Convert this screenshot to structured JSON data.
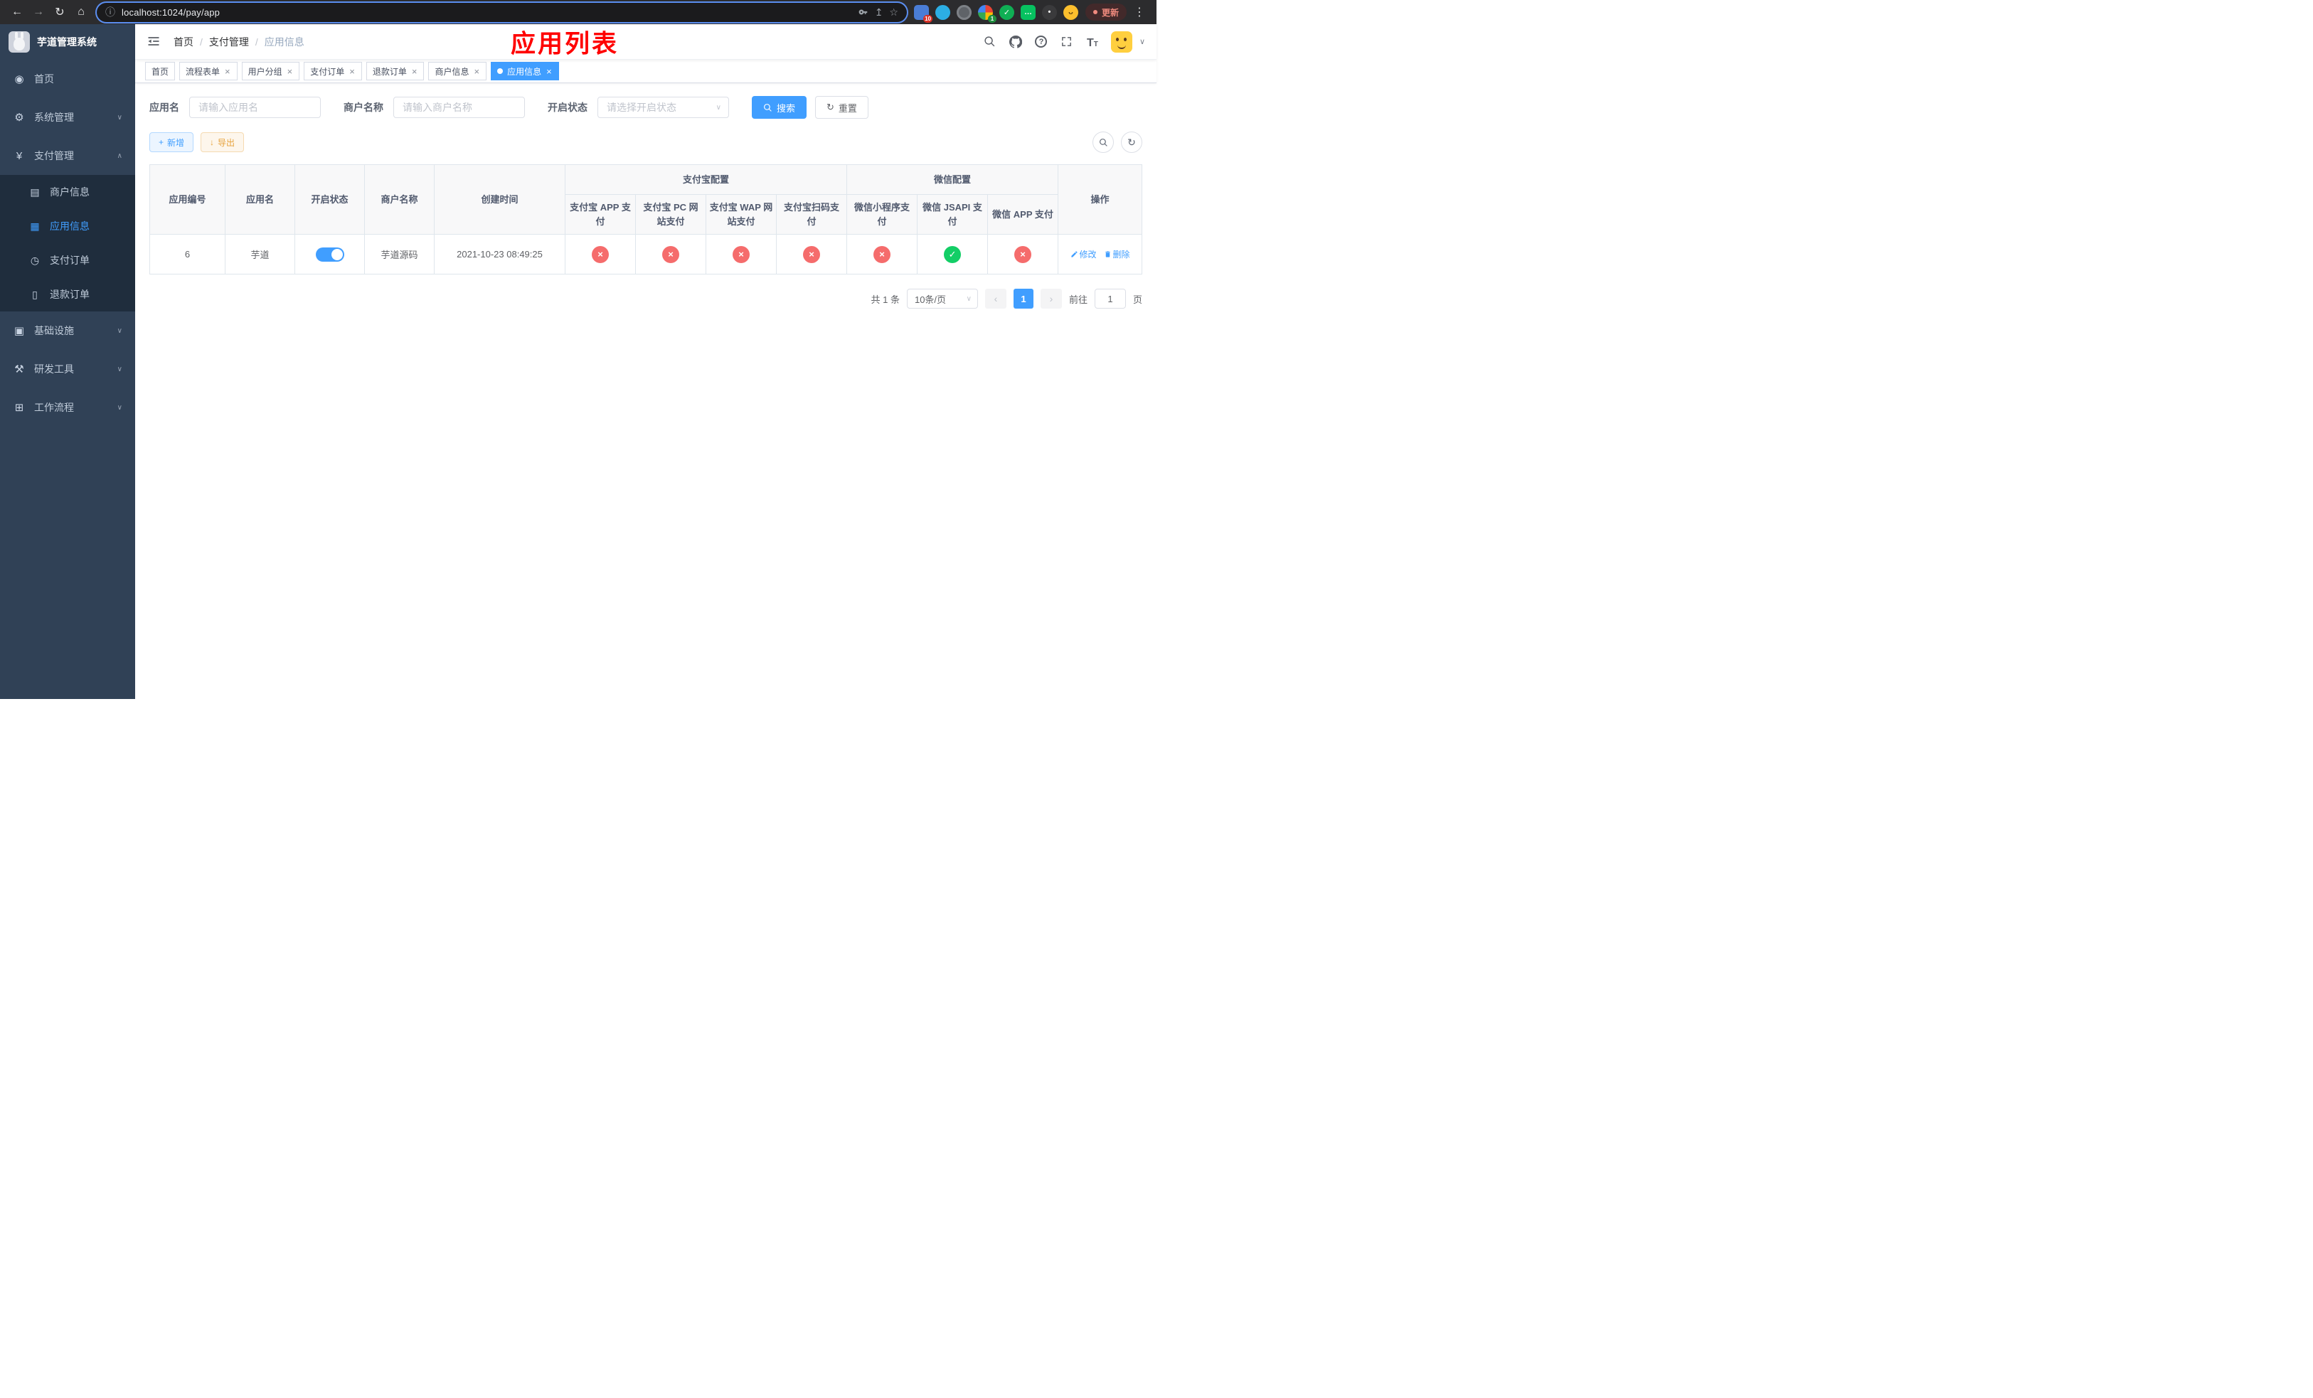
{
  "browser": {
    "url": "localhost:1024/pay/app",
    "update_label": "更新",
    "puzzle_badge": "10",
    "colorful_badge": "1"
  },
  "icons": {
    "back": "←",
    "forward": "→",
    "reload": "↻",
    "home": "⌂",
    "info": "ⓘ",
    "share": "↥",
    "star": "☆",
    "menu_dots": "⋮",
    "sidebar_home": "◉",
    "sidebar_system": "⚙",
    "sidebar_payment": "¥",
    "sidebar_merchant": "▤",
    "sidebar_app": "▦",
    "sidebar_pay_order": "◷",
    "sidebar_refund": "▯",
    "sidebar_infra": "▣",
    "sidebar_devtools": "⚒",
    "sidebar_workflow": "⊞",
    "chevron_down": "∨",
    "chevron_up": "∧",
    "caret_down": "∨",
    "plus": "+",
    "download": "↓",
    "refresh": "↻",
    "question": "?",
    "font_large": "T",
    "font_small": "T",
    "prev": "‹",
    "next": "›"
  },
  "sidebar": {
    "title": "芋道管理系统",
    "home": "首页",
    "system": "系统管理",
    "payment": "支付管理",
    "merchant_info": "商户信息",
    "app_info": "应用信息",
    "pay_order": "支付订单",
    "refund_order": "退款订单",
    "infrastructure": "基础设施",
    "dev_tools": "研发工具",
    "workflow": "工作流程"
  },
  "navbar": {
    "breadcrumb": [
      "首页",
      "支付管理",
      "应用信息"
    ],
    "annotation": "应用列表"
  },
  "tabs": [
    {
      "label": "首页"
    },
    {
      "label": "流程表单"
    },
    {
      "label": "用户分组"
    },
    {
      "label": "支付订单"
    },
    {
      "label": "退款订单"
    },
    {
      "label": "商户信息"
    },
    {
      "label": "应用信息"
    }
  ],
  "filters": {
    "app_name_label": "应用名",
    "app_name_placeholder": "请输入应用名",
    "merchant_label": "商户名称",
    "merchant_placeholder": "请输入商户名称",
    "status_label": "开启状态",
    "status_placeholder": "请选择开启状态",
    "search_label": "搜索",
    "reset_label": "重置"
  },
  "toolbar": {
    "add_label": "新增",
    "export_label": "导出"
  },
  "table": {
    "headers": {
      "app_id": "应用编号",
      "app_name": "应用名",
      "status": "开启状态",
      "merchant_name": "商户名称",
      "create_time": "创建时间",
      "alipay_group": "支付宝配置",
      "wechat_group": "微信配置",
      "alipay_app": "支付宝 APP 支付",
      "alipay_pc": "支付宝 PC 网站支付",
      "alipay_wap": "支付宝 WAP 网站支付",
      "alipay_qr": "支付宝扫码支付",
      "wechat_lite": "微信小程序支付",
      "wechat_jsapi": "微信 JSAPI 支付",
      "wechat_app": "微信 APP 支付",
      "actions": "操作"
    },
    "rows": [
      {
        "app_id": "6",
        "app_name": "芋道",
        "status": "on",
        "merchant_name": "芋道源码",
        "create_time": "2021-10-23 08:49:25",
        "channels": [
          {
            "key": "alipay_app",
            "state": "off",
            "glyph": "×"
          },
          {
            "key": "alipay_pc",
            "state": "off",
            "glyph": "×"
          },
          {
            "key": "alipay_wap",
            "state": "off",
            "glyph": "×"
          },
          {
            "key": "alipay_qr",
            "state": "off",
            "glyph": "×"
          },
          {
            "key": "wechat_lite",
            "state": "off",
            "glyph": "×"
          },
          {
            "key": "wechat_jsapi",
            "state": "on",
            "glyph": "✓"
          },
          {
            "key": "wechat_app",
            "state": "off",
            "glyph": "×"
          }
        ],
        "edit_label": "修改",
        "delete_label": "删除"
      }
    ]
  },
  "pagination": {
    "total_text": "共 1 条",
    "page_size": "10条/页",
    "current_page": "1",
    "jump_prefix": "前往",
    "jump_value": "1",
    "jump_suffix": "页"
  },
  "colors": {
    "accent": "#409eff",
    "danger": "#f56c6c",
    "success": "#13ce66",
    "warning": "#e6a23c",
    "annotation_red": "#ff0000",
    "sidebar_bg": "#304156",
    "sidebar_sub_bg": "#1f2d3d"
  }
}
